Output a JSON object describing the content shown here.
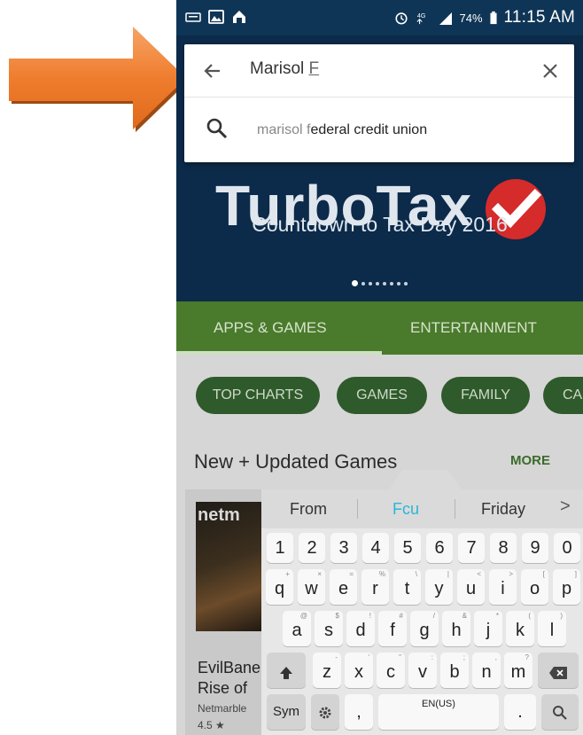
{
  "status_bar": {
    "battery_pct": "74%",
    "time": "11:15 AM"
  },
  "banner": {
    "title": "TurboTax",
    "subtitle": "Countdown to Tax Day 2016",
    "page_dots": 8,
    "active_dot": 0
  },
  "tabs": [
    {
      "label": "APPS & GAMES",
      "selected": true
    },
    {
      "label": "ENTERTAINMENT",
      "selected": false
    }
  ],
  "chips": [
    "TOP CHARTS",
    "GAMES",
    "FAMILY",
    "CA"
  ],
  "section": {
    "title": "New + Updated Games",
    "more": "MORE"
  },
  "app_card": {
    "thumb_text": "netm",
    "name_line1": "EvilBane",
    "name_line2": "Rise of",
    "developer": "Netmarble",
    "rating": "4.5 ★"
  },
  "search": {
    "query_main": "Marisol ",
    "query_composing": "F",
    "suggestion_prefix": "marisol f",
    "suggestion_rest": "ederal credit union"
  },
  "keyboard": {
    "predictions": [
      "From",
      "Fcu",
      "Friday"
    ],
    "highlight_color": "#29b6d8",
    "more_symbol": ">",
    "number_row": [
      "1",
      "2",
      "3",
      "4",
      "5",
      "6",
      "7",
      "8",
      "9",
      "0"
    ],
    "row_q": [
      {
        "k": "q",
        "s": "+"
      },
      {
        "k": "w",
        "s": "×"
      },
      {
        "k": "e",
        "s": "="
      },
      {
        "k": "r",
        "s": "%"
      },
      {
        "k": "t",
        "s": "\\"
      },
      {
        "k": "y",
        "s": "|"
      },
      {
        "k": "u",
        "s": "<"
      },
      {
        "k": "i",
        "s": ">"
      },
      {
        "k": "o",
        "s": "["
      },
      {
        "k": "p",
        "s": "]"
      }
    ],
    "row_a": [
      {
        "k": "a",
        "s": "@"
      },
      {
        "k": "s",
        "s": "$"
      },
      {
        "k": "d",
        "s": "!"
      },
      {
        "k": "f",
        "s": "#"
      },
      {
        "k": "g",
        "s": "/"
      },
      {
        "k": "h",
        "s": "&"
      },
      {
        "k": "j",
        "s": "*"
      },
      {
        "k": "k",
        "s": "("
      },
      {
        "k": "l",
        "s": ")"
      }
    ],
    "row_z": [
      {
        "k": "z",
        "s": "-"
      },
      {
        "k": "x",
        "s": "'"
      },
      {
        "k": "c",
        "s": "\""
      },
      {
        "k": "v",
        "s": ":"
      },
      {
        "k": "b",
        "s": ";"
      },
      {
        "k": "n",
        "s": ","
      },
      {
        "k": "m",
        "s": "?"
      }
    ],
    "sym_label": "Sym",
    "comma_label": ",",
    "space_label": "EN(US)",
    "period_label": "."
  }
}
